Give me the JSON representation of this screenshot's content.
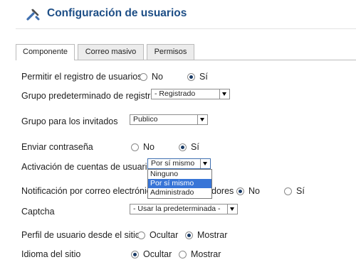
{
  "title": "Configuración de usuarios",
  "tabs": [
    {
      "label": "Componente"
    },
    {
      "label": "Correo masivo"
    },
    {
      "label": "Permisos"
    }
  ],
  "rows": {
    "registro": {
      "label": "Permitir el registro de usuarios",
      "options": [
        "No",
        "Sí"
      ],
      "selected": "Sí"
    },
    "grupo_registro": {
      "label": "Grupo predeterminado de registro",
      "value": "- Registrado"
    },
    "grupo_invitados": {
      "label": "Grupo para los invitados",
      "value": "Publico"
    },
    "contrasena": {
      "label": "Enviar contraseña",
      "options": [
        "No",
        "Sí"
      ],
      "selected": "Sí"
    },
    "activacion": {
      "label": "Activación de cuentas de usuario",
      "value": "Por sí mismo",
      "dropdown_options": [
        "Ninguno",
        "Por sí mismo",
        "Administrado"
      ],
      "highlighted": "Por sí mismo"
    },
    "notificacion": {
      "label_start": "Notificación por correo electrónico",
      "label_end": "dores",
      "options": [
        "No",
        "Sí"
      ],
      "selected": "No"
    },
    "captcha": {
      "label": "Captcha",
      "value": "- Usar la predeterminada -"
    },
    "perfil": {
      "label": "Perfil de usuario desde el sitio",
      "options": [
        "Ocultar",
        "Mostrar"
      ],
      "selected": "Mostrar"
    },
    "idioma": {
      "label": "Idioma del sitio",
      "options": [
        "Ocultar",
        "Mostrar"
      ],
      "selected": "Ocultar"
    }
  }
}
